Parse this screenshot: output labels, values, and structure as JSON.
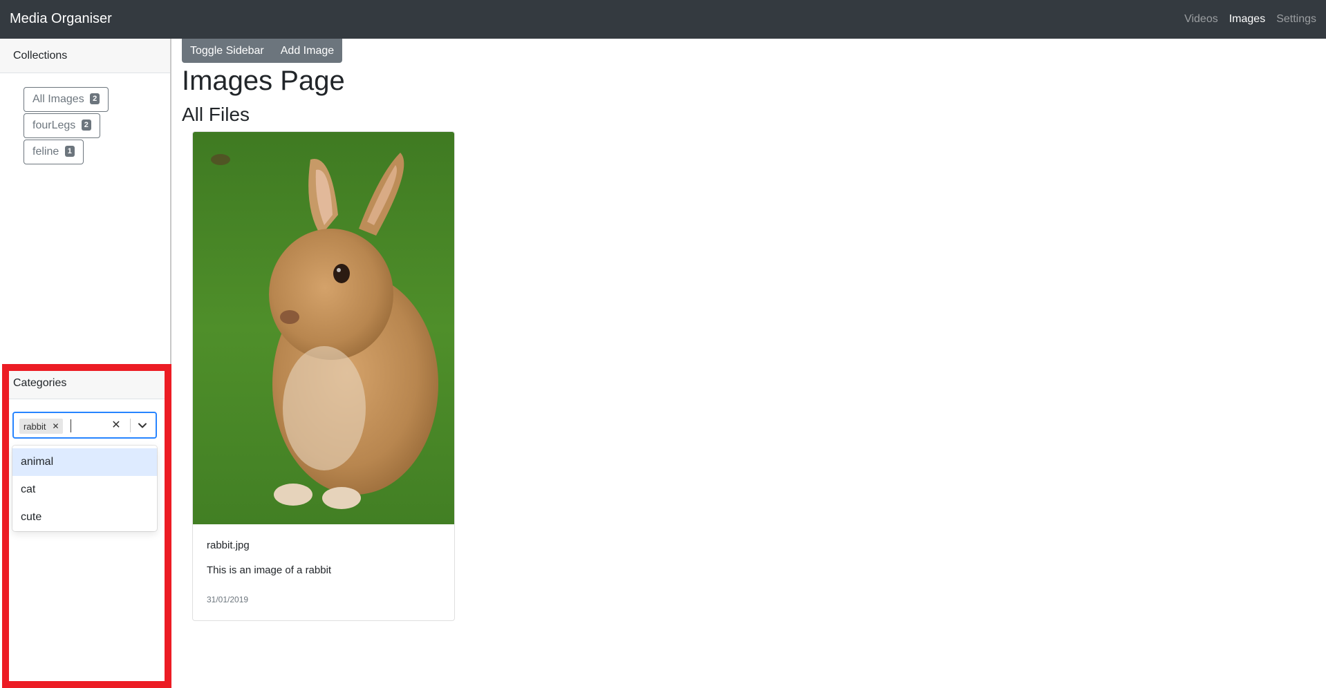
{
  "navbar": {
    "brand": "Media Organiser",
    "links": [
      {
        "label": "Videos",
        "active": false
      },
      {
        "label": "Images",
        "active": true
      },
      {
        "label": "Settings",
        "active": false
      }
    ]
  },
  "sidebar": {
    "collections_title": "Collections",
    "collections": [
      {
        "label": "All Images",
        "count": "2"
      },
      {
        "label": "fourLegs",
        "count": "2"
      },
      {
        "label": "feline",
        "count": "1"
      }
    ],
    "categories_title": "Categories",
    "selected_tag": "rabbit",
    "options": [
      "animal",
      "cat",
      "cute"
    ]
  },
  "toolbar": {
    "toggle_label": "Toggle Sidebar",
    "add_label": "Add Image"
  },
  "main": {
    "page_title": "Images Page",
    "section_title": "All Files"
  },
  "card": {
    "title": "rabbit.jpg",
    "description": "This is an image of a rabbit",
    "date": "31/01/2019"
  },
  "colors": {
    "navbar_bg": "#343a40",
    "secondary": "#6c757d",
    "highlight": "#ec1c24",
    "focus": "#2684ff",
    "option_focused": "#deebff"
  }
}
